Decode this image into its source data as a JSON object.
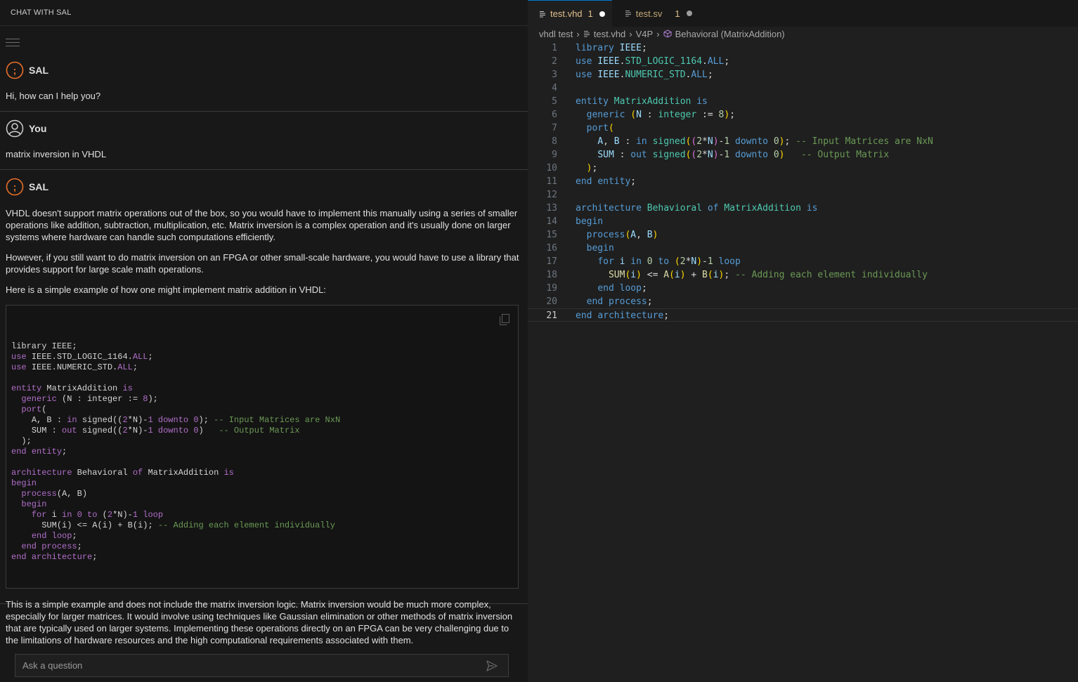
{
  "chat": {
    "header": "CHAT WITH SAL",
    "messages": [
      {
        "sender": "SAL",
        "text": "Hi, how can I help you?"
      },
      {
        "sender": "You",
        "text": "matrix inversion in VHDL"
      },
      {
        "sender": "SAL",
        "paragraphs": [
          "VHDL doesn't support matrix operations out of the box, so you would have to implement this manually using a series of smaller operations like addition, subtraction, multiplication, etc. Matrix inversion is a complex operation and it's usually done on larger systems where hardware can handle such computations efficiently.",
          "However, if you still want to do matrix inversion on an FPGA or other small-scale hardware, you would have to use a library that provides support for large scale math operations.",
          "Here is a simple example of how one might implement matrix addition in VHDL:"
        ],
        "after": "This is a simple example and does not include the matrix inversion logic. Matrix inversion would be much more complex, especially for larger matrices. It would involve using techniques like Gaussian elimination or other methods of matrix inversion that are typically used on larger systems. Implementing these operations directly on an FPGA can be very challenging due to the limitations of hardware resources and the high computational requirements associated with them."
      }
    ],
    "input_placeholder": "Ask a question"
  },
  "code_lines": [
    "library IEEE;",
    "use IEEE.STD_LOGIC_1164.ALL;",
    "use IEEE.NUMERIC_STD.ALL;",
    "",
    "entity MatrixAddition is",
    "  generic (N : integer := 8);",
    "  port(",
    "    A, B : in signed((2*N)-1 downto 0); -- Input Matrices are NxN",
    "    SUM : out signed((2*N)-1 downto 0)   -- Output Matrix",
    "  );",
    "end entity;",
    "",
    "architecture Behavioral of MatrixAddition is",
    "begin",
    "  process(A, B)",
    "  begin",
    "    for i in 0 to (2*N)-1 loop",
    "      SUM(i) <= A(i) + B(i); -- Adding each element individually",
    "    end loop;",
    "  end process;",
    "end architecture;"
  ],
  "editor": {
    "tabs": [
      {
        "name": "test.vhd",
        "count": "1",
        "active": true
      },
      {
        "name": "test.sv",
        "count": "1",
        "active": false
      }
    ],
    "breadcrumb": [
      "vhdl test",
      "test.vhd",
      "V4P",
      "Behavioral (MatrixAddition)"
    ],
    "current_line": 21
  },
  "colors": {
    "accent": "#0078d4",
    "sal_icon": "#e8702a",
    "modified_tab": "#e2c08d"
  }
}
